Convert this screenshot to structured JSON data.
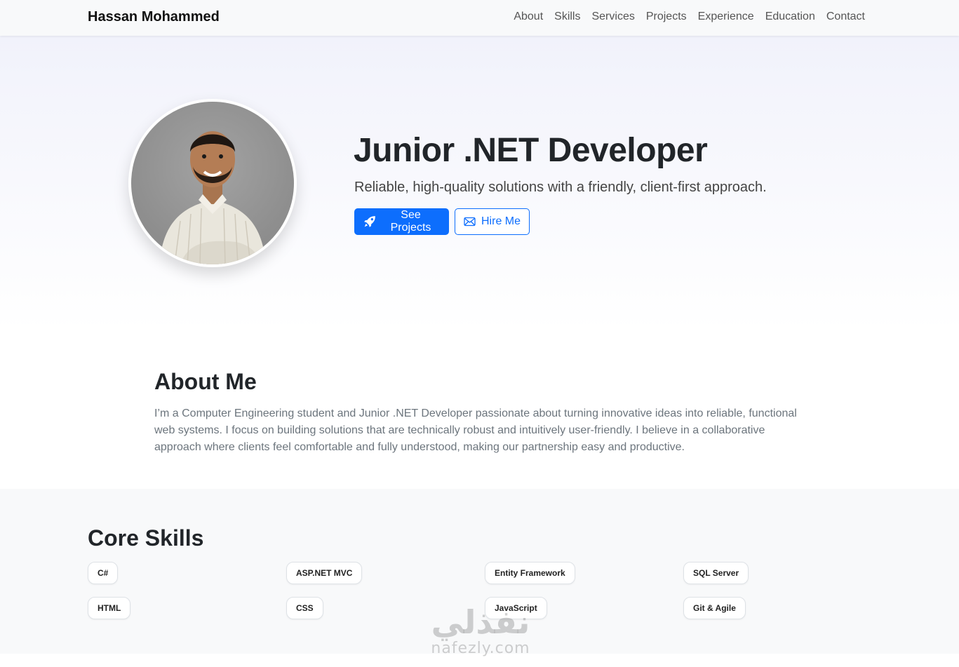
{
  "navbar": {
    "brand": "Hassan Mohammed",
    "links": [
      "About",
      "Skills",
      "Services",
      "Projects",
      "Experience",
      "Education",
      "Contact"
    ]
  },
  "hero": {
    "title": "Junior .NET Developer",
    "subtitle": "Reliable, high-quality solutions with a friendly, client-first approach.",
    "primary_button": "See Projects",
    "secondary_button": "Hire Me",
    "primary_icon": "rocket-icon",
    "secondary_icon": "envelope-icon"
  },
  "about": {
    "title": "About Me",
    "text": "I’m a Computer Engineering student and Junior .NET Developer passionate about turning innovative ideas into reliable, functional web systems. I focus on building solutions that are technically robust and intuitively user-friendly. I believe in a collaborative approach where clients feel comfortable and fully understood, making our partnership easy and productive."
  },
  "skills": {
    "title": "Core Skills",
    "items": [
      "C#",
      "ASP.NET MVC",
      "Entity Framework",
      "SQL Server",
      "HTML",
      "CSS",
      "JavaScript",
      "Git & Agile"
    ]
  },
  "watermark": {
    "arabic": "نفذلي",
    "latin": "nafezly.com"
  },
  "colors": {
    "primary": "#0d6efd",
    "navbar_bg": "#f8f9fa",
    "skills_bg": "#f8f9fa",
    "muted_text": "#6c757d"
  }
}
